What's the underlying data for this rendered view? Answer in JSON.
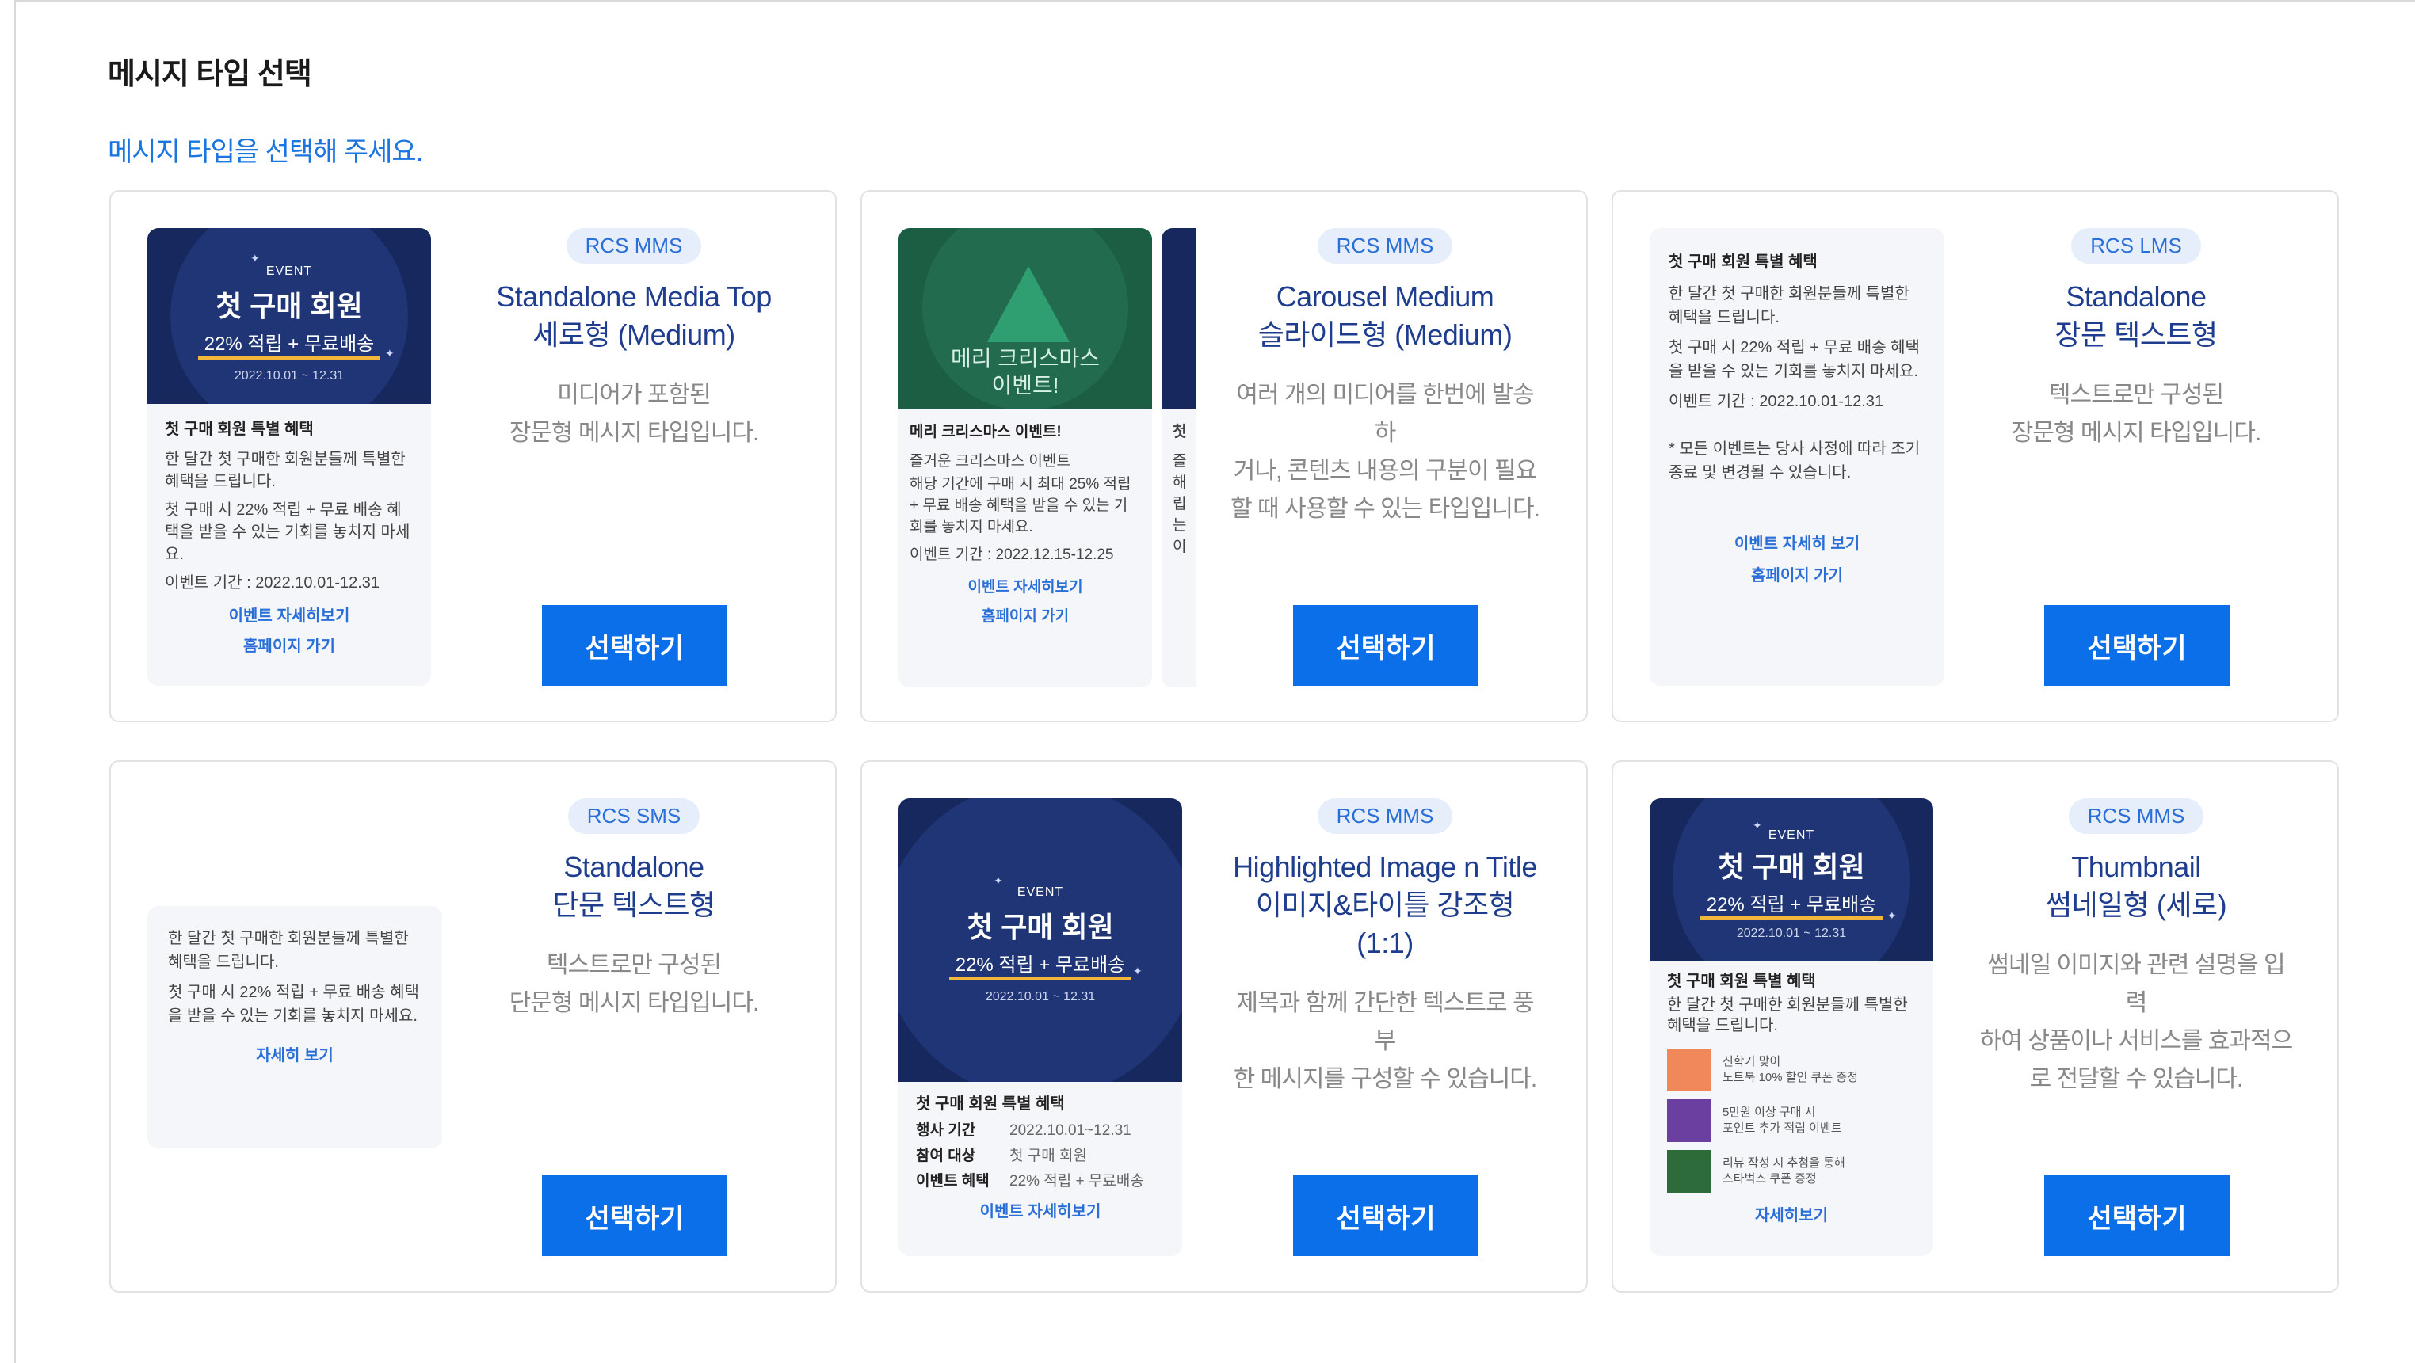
{
  "header": {
    "title": "메시지 타입 선택",
    "subtitle": "메시지 타입을 선택해 주세요."
  },
  "select_label": "선택하기",
  "banner": {
    "event": "EVENT",
    "big": "첫 구매 회원",
    "sub": "22% 적립 + 무료배송",
    "date": "2022.10.01 ~ 12.31"
  },
  "cards": [
    {
      "badge": "RCS MMS",
      "title1": "Standalone Media Top",
      "title2": "세로형 (Medium)",
      "desc1": "미디어가 포함된",
      "desc2": "장문형 메시지 타입입니다.",
      "preview": {
        "title": "첫 구매 회원 특별 혜택",
        "line1": "한 달간 첫 구매한 회원분들께 특별한 혜택을 드립니다.",
        "line2": "첫 구매 시 22% 적립 + 무료 배송 혜택을 받을 수 있는 기회를 놓치지 마세요.",
        "line3": "이벤트 기간 : 2022.10.01-12.31",
        "link1": "이벤트 자세히보기",
        "link2": "홈페이지 가기"
      }
    },
    {
      "badge": "RCS MMS",
      "title1": "Carousel Medium",
      "title2": "슬라이드형 (Medium)",
      "desc1": "여러 개의 미디어를 한번에 발송하",
      "desc2": "거나, 콘텐츠 내용의 구분이 필요",
      "desc3": "할 때 사용할 수 있는 타입입니다.",
      "preview": {
        "image_text1": "메리 크리스마스",
        "image_text2": "이벤트!",
        "title": "메리 크리스마스 이벤트!",
        "line1": "즐거운 크리스마스 이벤트",
        "line2": "해당 기간에 구매 시 최대 25% 적립 + 무료 배송 혜택을 받을 수 있는 기회를 놓치지 마세요.",
        "line3": "이벤트 기간 : 2022.12.15-12.25",
        "link1": "이벤트 자세히보기",
        "link2": "홈페이지 가기",
        "peek_title": "첫",
        "peek_lines": [
          "즐",
          "해",
          "립",
          "는",
          "이"
        ]
      }
    },
    {
      "badge": "RCS LMS",
      "title1": "Standalone",
      "title2": "장문 텍스트형",
      "desc1": "텍스트로만 구성된",
      "desc2": "장문형 메시지 타입입니다.",
      "preview": {
        "title": "첫 구매 회원 특별 혜택",
        "line1": "한 달간 첫 구매한 회원분들께 특별한 혜택을 드립니다.",
        "line2": "첫 구매 시 22% 적립 + 무료 배송 혜택을 받을 수 있는 기회를 놓치지 마세요.",
        "line3": "이벤트 기간 : 2022.10.01-12.31",
        "line4": "* 모든 이벤트는 당사 사정에 따라 조기 종료 및 변경될 수 있습니다.",
        "link1": "이벤트 자세히 보기",
        "link2": "홈페이지 가기"
      }
    },
    {
      "badge": "RCS SMS",
      "title1": "Standalone",
      "title2": "단문 텍스트형",
      "desc1": "텍스트로만 구성된",
      "desc2": "단문형 메시지 타입입니다.",
      "preview": {
        "line1": "한 달간 첫 구매한 회원분들께 특별한 혜택을 드립니다.",
        "line2": "첫 구매 시 22% 적립 + 무료 배송 혜택을 받을 수 있는 기회를 놓치지 마세요.",
        "link1": "자세히 보기"
      }
    },
    {
      "badge": "RCS MMS",
      "title1": "Highlighted Image n Title",
      "title2": "이미지&타이틀 강조형 (1:1)",
      "desc1": "제목과 함께 간단한 텍스트로 풍부",
      "desc2": "한 메시지를 구성할 수 있습니다.",
      "preview": {
        "title": "첫 구매 회원 특별 혜택",
        "k1": "행사 기간",
        "v1": "2022.10.01~12.31",
        "k2": "참여 대상",
        "v2": "첫 구매 회원",
        "k3": "이벤트 혜택",
        "v3": "22% 적립 + 무료배송",
        "link1": "이벤트 자세히보기"
      }
    },
    {
      "badge": "RCS MMS",
      "title1": "Thumbnail",
      "title2": "썸네일형 (세로)",
      "desc1": "썸네일 이미지와 관련 설명을 입력",
      "desc2": "하여 상품이나 서비스를 효과적으",
      "desc3": "로 전달할 수 있습니다.",
      "preview": {
        "title": "첫 구매 회원 특별 혜택",
        "line1": "한 달간 첫 구매한 회원분들께 특별한 혜택을 드립니다.",
        "t1a": "신학기 맞이",
        "t1b": "노트북 10% 할인 쿠폰 증정",
        "t2a": "5만원 이상 구매 시",
        "t2b": "포인트 추가 적립 이벤트",
        "t3a": "리뷰 작성 시 추첨을 통해",
        "t3b": "스타벅스 쿠폰 증정",
        "link1": "자세히보기"
      }
    }
  ],
  "colors": {
    "accent": "#0a6fe8",
    "navy": "#16285e",
    "title_blue": "#1e3d8f",
    "thumb1": "#f0885a",
    "thumb2": "#6b3fa0",
    "thumb3": "#2e6b3a"
  }
}
